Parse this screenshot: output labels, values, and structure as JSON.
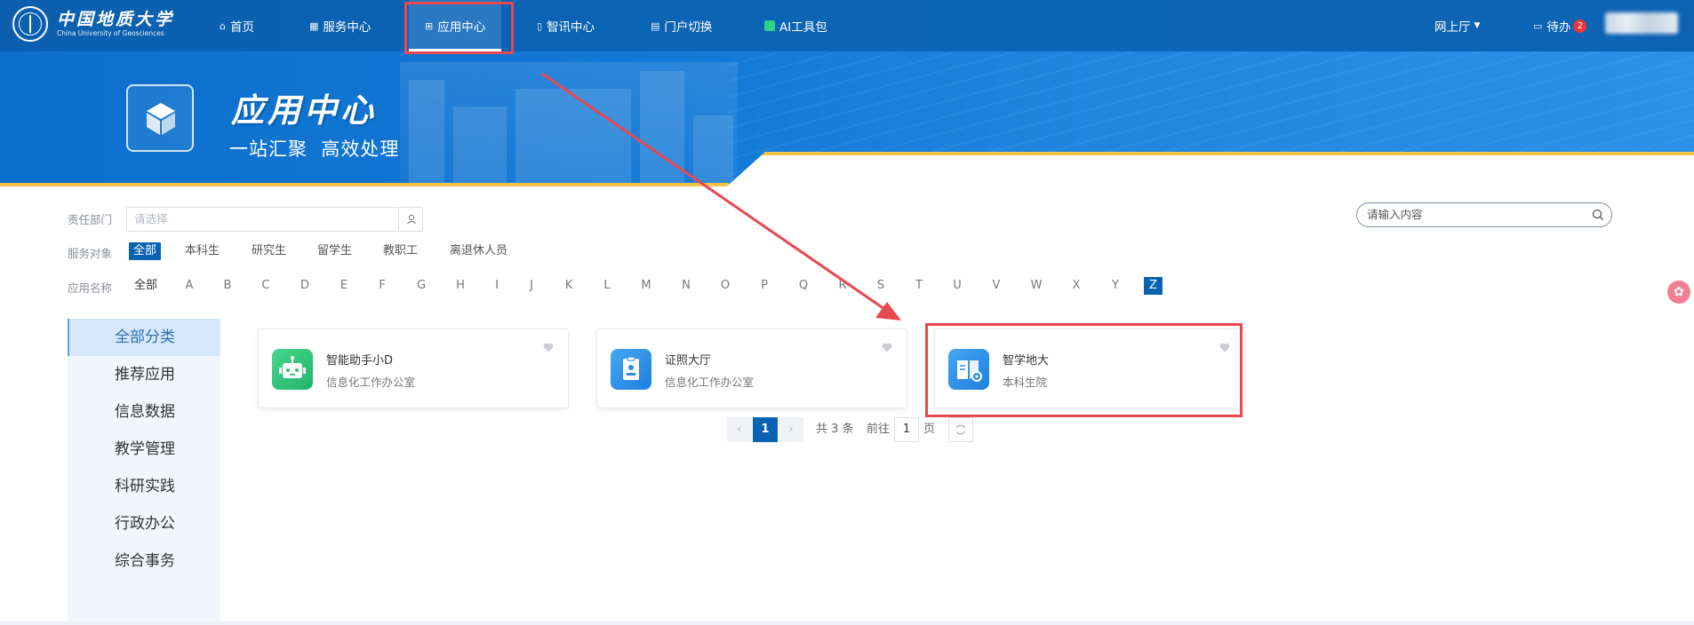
{
  "header": {
    "logo_cn": "中国地质大学",
    "logo_en": "China University of Geosciences",
    "nav": [
      {
        "label": "首页",
        "icon": "home-icon"
      },
      {
        "label": "服务中心",
        "icon": "grid-icon"
      },
      {
        "label": "应用中心",
        "icon": "apps-icon",
        "active": true
      },
      {
        "label": "智讯中心",
        "icon": "document-icon"
      },
      {
        "label": "门户切换",
        "icon": "switch-icon"
      },
      {
        "label": "AI工具包",
        "icon": "ai-icon"
      }
    ],
    "portal_menu": "网上厅",
    "todo_label": "待办",
    "todo_count": "2"
  },
  "banner": {
    "title": "应用中心",
    "subtitle": "一站汇聚  高效处理"
  },
  "filters": {
    "department_label": "责任部门",
    "department_placeholder": "请选择",
    "audience_label": "服务对象",
    "audience_options": [
      "全部",
      "本科生",
      "研究生",
      "留学生",
      "教职工",
      "离退休人员"
    ],
    "audience_selected": "全部",
    "app_name_label": "应用名称",
    "letters": [
      "全部",
      "A",
      "B",
      "C",
      "D",
      "E",
      "F",
      "G",
      "H",
      "I",
      "J",
      "K",
      "L",
      "M",
      "N",
      "O",
      "P",
      "Q",
      "R",
      "S",
      "T",
      "U",
      "V",
      "W",
      "X",
      "Y",
      "Z"
    ],
    "letter_selected": "Z",
    "search_placeholder": "请输入内容"
  },
  "sidebar": {
    "items": [
      "全部分类",
      "推荐应用",
      "信息数据",
      "教学管理",
      "科研实践",
      "行政办公",
      "综合事务"
    ],
    "active": "全部分类"
  },
  "apps": [
    {
      "name": "智能助手小D",
      "dept": "信息化工作办公室",
      "icon": "robot-icon",
      "color": "#2fc27a"
    },
    {
      "name": "证照大厅",
      "dept": "信息化工作办公室",
      "icon": "id-card-icon",
      "color": "#2b8ee8"
    },
    {
      "name": "智学地大",
      "dept": "本科生院",
      "icon": "book-icon",
      "color": "#2b8ee8"
    }
  ],
  "pagination": {
    "current": "1",
    "total_text": "共 3 条",
    "goto_label": "前往",
    "goto_value": "1",
    "page_suffix": "页"
  },
  "colors": {
    "nav_bg": "#0b5fae",
    "accent": "#0a63b1",
    "annotation": "#e8484f"
  }
}
